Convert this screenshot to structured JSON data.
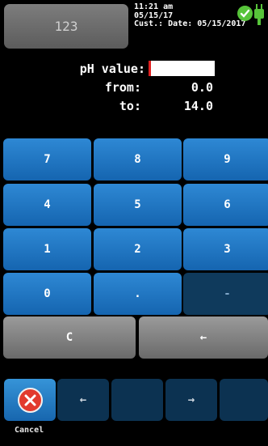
{
  "header": {
    "display_value": "123",
    "time": "11:21 am",
    "date": "05/15/17",
    "cust_date": "Cust.: Date: 05/15/2017"
  },
  "form": {
    "ph_label": "pH value:",
    "ph_value": "",
    "from_label": "from:",
    "from_value": "0.0",
    "to_label": "to:",
    "to_value": "14.0"
  },
  "keypad": {
    "k7": "7",
    "k8": "8",
    "k9": "9",
    "k4": "4",
    "k5": "5",
    "k6": "6",
    "k1": "1",
    "k2": "2",
    "k3": "3",
    "k0": "0",
    "dot": ".",
    "minus": "-",
    "clear": "C",
    "backspace": "←"
  },
  "bottom_bar": {
    "cancel_label": "Cancel",
    "left_arrow": "←",
    "right_arrow": "→"
  },
  "colors": {
    "key_blue": "#1f78c4",
    "key_disabled": "#0f3a5c",
    "key_gray": "#7a7a7a",
    "status_ok": "#57c43a",
    "cancel_red": "#e23a2e"
  }
}
